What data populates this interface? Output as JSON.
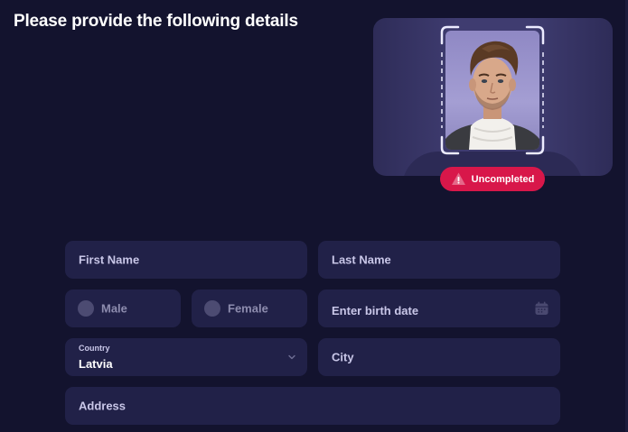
{
  "page": {
    "title": "Please provide the following details"
  },
  "photo": {
    "status_label": "Uncompleted",
    "status_color": "#d8174a",
    "status_icon": "warning-icon"
  },
  "form": {
    "first_name": {
      "placeholder": "First Name"
    },
    "last_name": {
      "placeholder": "Last Name"
    },
    "gender": {
      "options": [
        "Male",
        "Female"
      ]
    },
    "birth_date": {
      "placeholder": "Enter birth date",
      "icon": "calendar-icon"
    },
    "country": {
      "label": "Country",
      "value": "Latvia",
      "icon": "chevron-down-icon"
    },
    "city": {
      "placeholder": "City"
    },
    "address": {
      "placeholder": "Address"
    }
  },
  "colors": {
    "background": "#13132e",
    "field_background": "#212148",
    "accent_danger": "#d8174a"
  }
}
